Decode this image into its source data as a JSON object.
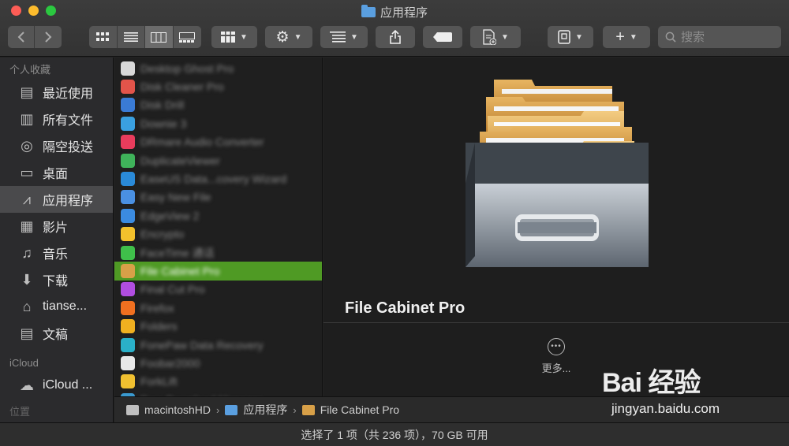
{
  "window": {
    "title": "应用程序"
  },
  "toolbar": {
    "back_icon": "chevron-left-icon",
    "forward_icon": "chevron-right-icon",
    "view_modes": [
      "icon-view",
      "list-view",
      "column-view",
      "gallery-view"
    ],
    "selected_view": "column-view",
    "search_placeholder": "搜索"
  },
  "sidebar": {
    "favorites_header": "个人收藏",
    "favorites": [
      {
        "label": "最近使用",
        "icon": "recents-icon"
      },
      {
        "label": "所有文件",
        "icon": "all-files-icon"
      },
      {
        "label": "隔空投送",
        "icon": "airdrop-icon"
      },
      {
        "label": "桌面",
        "icon": "desktop-icon"
      },
      {
        "label": "应用程序",
        "icon": "applications-icon",
        "selected": true
      },
      {
        "label": "影片",
        "icon": "movies-icon"
      },
      {
        "label": "音乐",
        "icon": "music-icon"
      },
      {
        "label": "下载",
        "icon": "downloads-icon"
      },
      {
        "label": "tianse...",
        "icon": "home-icon"
      },
      {
        "label": "文稿",
        "icon": "documents-icon"
      }
    ],
    "icloud_header": "iCloud",
    "icloud": [
      {
        "label": "iCloud ...",
        "icon": "cloud-icon"
      }
    ],
    "locations_header": "位置"
  },
  "app_list": [
    {
      "name": "Desktop Ghost Pro",
      "color": "#d8d8d8"
    },
    {
      "name": "Disk Cleaner Pro",
      "color": "#e2544a"
    },
    {
      "name": "Disk Drill",
      "color": "#3a7bd5"
    },
    {
      "name": "Downie 3",
      "color": "#3aa0e0"
    },
    {
      "name": "DRmare Audio Converter",
      "color": "#e83c5c"
    },
    {
      "name": "DuplicateViewer",
      "color": "#3fb35a"
    },
    {
      "name": "EaseUS Data...covery Wizard",
      "color": "#2a8ad8"
    },
    {
      "name": "Easy New File",
      "color": "#4a90e2"
    },
    {
      "name": "EdgeView 2",
      "color": "#3b8be0"
    },
    {
      "name": "Encrypto",
      "color": "#f3c12c"
    },
    {
      "name": "FaceTime 通话",
      "color": "#3fbf4a"
    },
    {
      "name": "File Cabinet Pro",
      "color": "#d8a048",
      "selected": true
    },
    {
      "name": "Final Cut Pro",
      "color": "#b04de0"
    },
    {
      "name": "Firefox",
      "color": "#f07020"
    },
    {
      "name": "Folders",
      "color": "#f0b020"
    },
    {
      "name": "FonePaw Data Recovery",
      "color": "#2ab0c8"
    },
    {
      "name": "Foobar2000",
      "color": "#e8e8e8"
    },
    {
      "name": "ForkLift",
      "color": "#f0c030"
    },
    {
      "name": "Free Download Manager",
      "color": "#3a9ad0"
    }
  ],
  "preview": {
    "app_name": "File Cabinet Pro",
    "more_label": "更多..."
  },
  "path_bar": [
    {
      "label": "macintoshHD",
      "icon": "disk-icon",
      "color": "#bfbfbf"
    },
    {
      "label": "应用程序",
      "icon": "folder-icon",
      "color": "#5a9fe0"
    },
    {
      "label": "File Cabinet Pro",
      "icon": "app-icon",
      "color": "#d8a048"
    }
  ],
  "status_text": "选择了 1 项（共 236 项），70 GB 可用",
  "watermark": {
    "brand": "Bai 经验",
    "url": "jingyan.baidu.com"
  }
}
